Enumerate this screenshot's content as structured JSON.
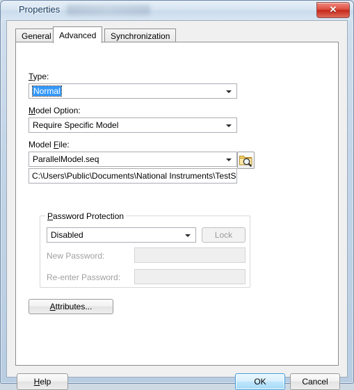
{
  "window": {
    "title": "Properties",
    "title_redacted_present": true,
    "close_label": "✕",
    "close_icon": "close-icon"
  },
  "tabs": [
    {
      "label": "General",
      "selected": false
    },
    {
      "label": "Advanced",
      "selected": true
    },
    {
      "label": "Synchronization",
      "selected": false
    }
  ],
  "advanced": {
    "type": {
      "label": "Type:",
      "accelerator": "T",
      "value": "Normal",
      "selected": true
    },
    "model_option": {
      "label": "Model Option:",
      "accelerator": "M",
      "value": "Require Specific Model"
    },
    "model_file": {
      "label": "Model File:",
      "accelerator": "F",
      "value": "ParallelModel.seq",
      "path": "C:\\Users\\Public\\Documents\\National Instruments\\TestStand",
      "browse_icon": "folder-search-icon"
    },
    "password_protection": {
      "title": "Password Protection",
      "accelerator": "P",
      "state_value": "Disabled",
      "lock_label": "Lock",
      "lock_enabled": false,
      "new_password_label": "New Password:",
      "new_password_value": "",
      "reenter_password_label": "Re-enter Password:",
      "reenter_password_value": "",
      "fields_enabled": false
    },
    "attributes_button": "Attributes..."
  },
  "footer": {
    "help": "Help",
    "ok": "OK",
    "cancel": "Cancel"
  },
  "colors": {
    "accent_selection": "#3399ff",
    "default_button_border": "#3c9ada",
    "close_button": "#c5281a"
  }
}
